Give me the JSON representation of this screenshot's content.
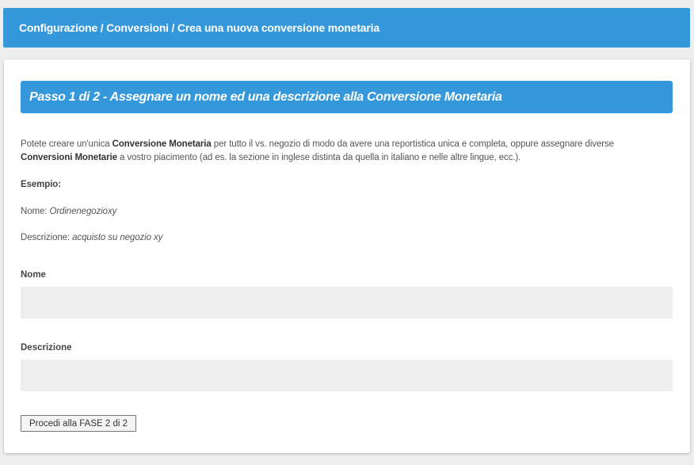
{
  "breadcrumb": {
    "text": "Configurazione / Conversioni / Crea una nuova conversione monetaria"
  },
  "step": {
    "title": "Passo 1 di 2 - Assegnare un nome ed una descrizione alla Conversione Monetaria"
  },
  "intro": {
    "part1": "Potete creare un'unica ",
    "bold1": "Conversione Monetaria",
    "part2": " per tutto il vs. negozio di modo da avere una reportistica unica e completa, oppure assegnare diverse ",
    "bold2": "Conversioni Monetarie",
    "part3": " a vostro piacimento (ad es. la sezione in inglese distinta da quella in italiano e nelle altre lingue, ecc.)."
  },
  "example": {
    "heading": "Esempio:",
    "name_label": "Nome: ",
    "name_value": "Ordinenegozioxy",
    "desc_label": "Descrizione: ",
    "desc_value": "acquisto su negozio xy"
  },
  "form": {
    "name_label": "Nome",
    "name_value": "",
    "desc_label": "Descrizione",
    "desc_value": "",
    "submit_label": "Procedi alla FASE 2 di 2"
  },
  "colors": {
    "accent": "#3498db",
    "input_bg": "#eeeeee",
    "page_bg": "#eeeeee"
  }
}
